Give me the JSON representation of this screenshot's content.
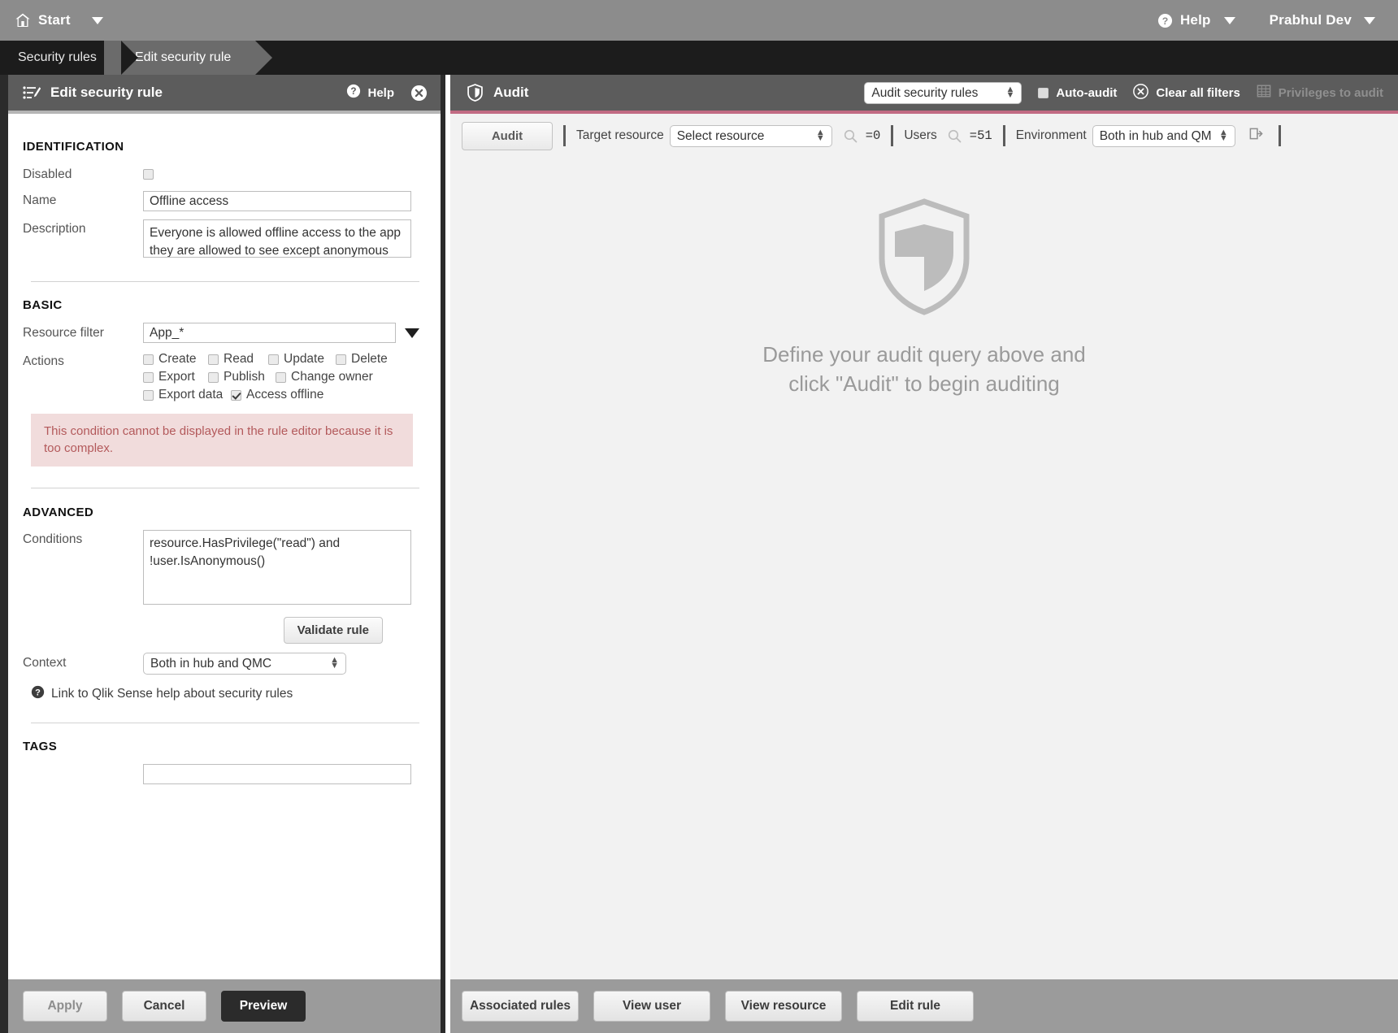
{
  "topbar": {
    "start_label": "Start",
    "help_label": "Help",
    "user_label": "Prabhul Dev"
  },
  "breadcrumb": {
    "items": [
      {
        "label": "Security rules"
      },
      {
        "label": "Edit security rule"
      }
    ]
  },
  "left_panel": {
    "title": "Edit security rule",
    "help_label": "Help",
    "sections": {
      "identification": {
        "heading": "IDENTIFICATION",
        "disabled_label": "Disabled",
        "disabled_checked": false,
        "name_label": "Name",
        "name_value": "Offline access",
        "description_label": "Description",
        "description_value": "Everyone is allowed offline access to the app they are allowed to see except anonymous"
      },
      "basic": {
        "heading": "BASIC",
        "resource_filter_label": "Resource filter",
        "resource_filter_value": "App_*",
        "actions_label": "Actions",
        "actions": [
          {
            "label": "Create",
            "checked": false
          },
          {
            "label": "Read",
            "checked": false
          },
          {
            "label": "Update",
            "checked": false
          },
          {
            "label": "Delete",
            "checked": false
          },
          {
            "label": "Export",
            "checked": false
          },
          {
            "label": "Publish",
            "checked": false
          },
          {
            "label": "Change owner",
            "checked": false
          },
          {
            "label": "Export data",
            "checked": false
          },
          {
            "label": "Access offline",
            "checked": true
          }
        ],
        "warning": "This condition cannot be displayed in the rule editor because it is too complex."
      },
      "advanced": {
        "heading": "ADVANCED",
        "conditions_label": "Conditions",
        "conditions_value": "resource.HasPrivilege(\"read\") and !user.IsAnonymous()",
        "validate_label": "Validate rule",
        "context_label": "Context",
        "context_value": "Both in hub and QMC",
        "help_link": "Link to Qlik Sense help about security rules"
      },
      "tags": {
        "heading": "TAGS",
        "value": ""
      }
    },
    "footer": {
      "apply": "Apply",
      "cancel": "Cancel",
      "preview": "Preview"
    }
  },
  "right_panel": {
    "title": "Audit",
    "mode_value": "Audit security rules",
    "auto_audit_label": "Auto-audit",
    "auto_audit_checked": false,
    "clear_filters_label": "Clear all filters",
    "privileges_label": "Privileges to audit",
    "toolbar": {
      "audit_button": "Audit",
      "target_resource_label": "Target resource",
      "target_resource_value": "Select resource",
      "resource_count": "=0",
      "users_label": "Users",
      "users_count": "=51",
      "environment_label": "Environment",
      "environment_value": "Both in hub and QMC"
    },
    "empty_state": {
      "line1": "Define your audit query above and",
      "line2": "click \"Audit\" to begin auditing"
    },
    "footer": {
      "associated_rules": "Associated rules",
      "view_user": "View user",
      "view_resource": "View resource",
      "edit_rule": "Edit rule"
    }
  },
  "colors": {
    "topbar_bg": "#8c8c8c",
    "crumb_bg": "#1c1c1c",
    "panel_header_bg": "#5c5c5c",
    "audit_accent": "#c16b83",
    "warning_bg": "#f1dcdc",
    "warning_text": "#b3595b",
    "footer_bg": "#9b9b9b"
  },
  "icons": {
    "home": "home-icon",
    "caret": "caret-down-icon",
    "help": "question-circle-icon",
    "rule": "rule-list-icon",
    "close": "close-icon",
    "shield": "shield-icon",
    "clear": "x-circle-icon",
    "grid": "grid-table-icon",
    "search": "search-icon",
    "export": "export-icon"
  }
}
